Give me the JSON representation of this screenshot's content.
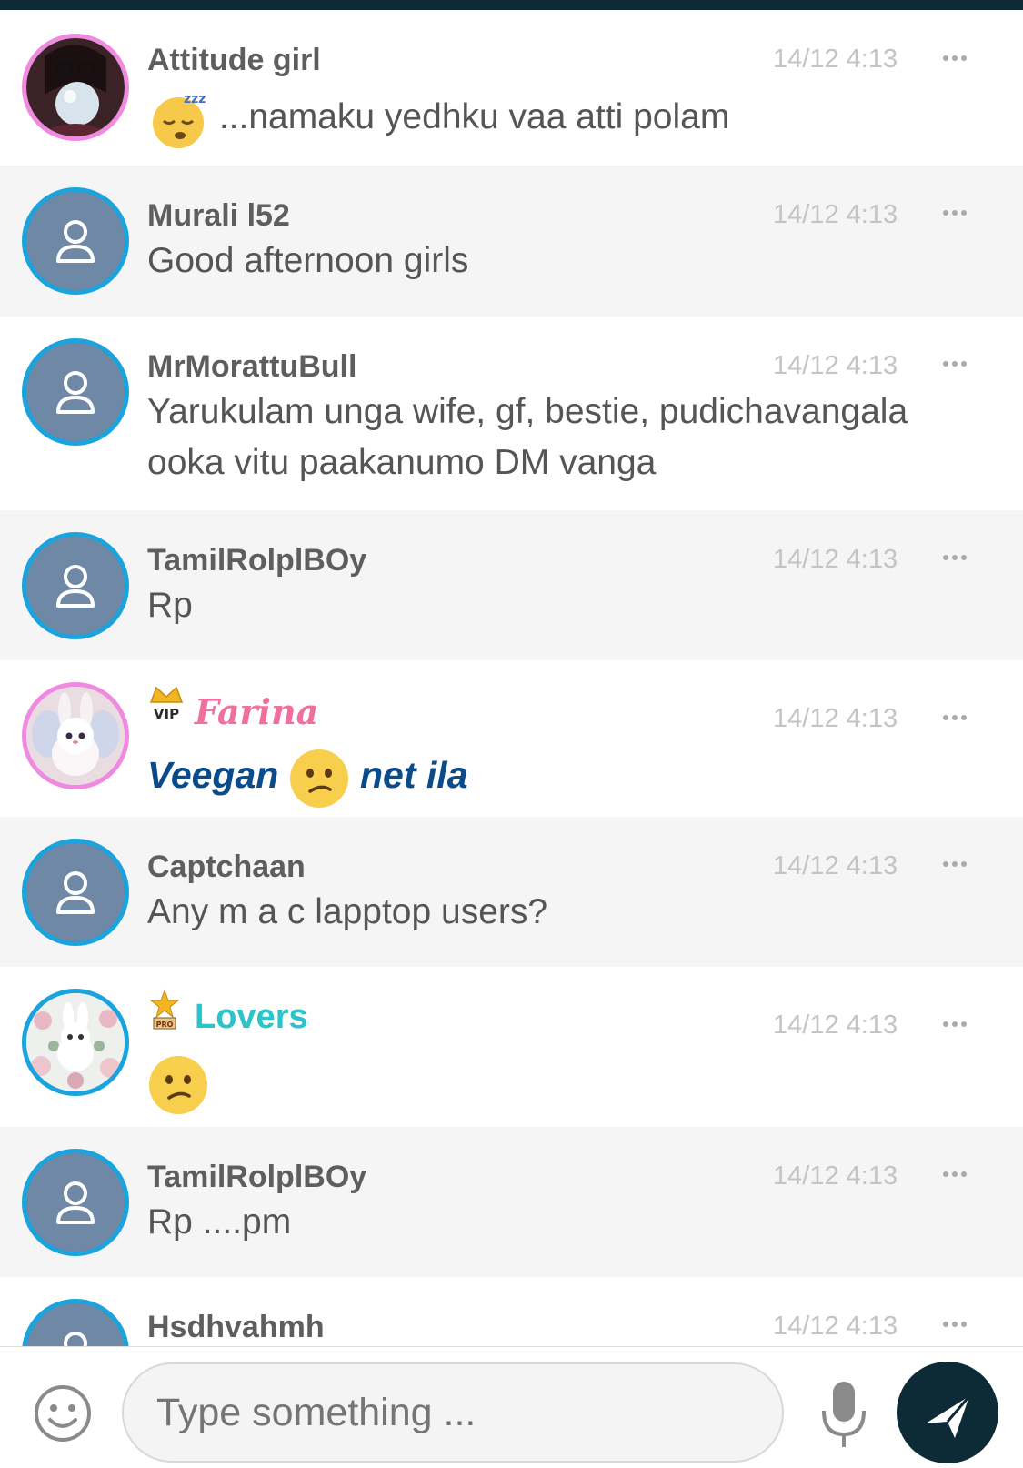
{
  "messages": [
    {
      "name": "Attitude girl",
      "time": "14/12 4:13",
      "text": "...namaku yedhku vaa atti polam",
      "avatar": "photo",
      "emoji": "sleeping-face"
    },
    {
      "name": "Murali l52",
      "time": "14/12 4:13",
      "text": "Good afternoon girls",
      "avatar": "default"
    },
    {
      "name": "MrMorattuBull",
      "time": "14/12 4:13",
      "text": "Yarukulam unga wife, gf, bestie, pudichavangala ooka vitu paakanumo DM vanga",
      "avatar": "default"
    },
    {
      "name": "TamilRolplBOy",
      "time": "14/12 4:13",
      "text": "Rp",
      "avatar": "default"
    },
    {
      "name": "Farina",
      "time": "14/12 4:13",
      "badge": "VIP",
      "text_before": "Veegan",
      "text_after": "net ila",
      "avatar": "bunny",
      "emoji": "confused-face"
    },
    {
      "name": "Captchaan",
      "time": "14/12 4:13",
      "text": "Any m a c lapptop users?",
      "avatar": "default"
    },
    {
      "name": "Lovers",
      "time": "14/12 4:13",
      "badge": "PRO",
      "avatar": "bunny-flowers",
      "emoji": "confused-face"
    },
    {
      "name": "TamilRolplBOy",
      "time": "14/12 4:13",
      "text": "Rp ....pm",
      "avatar": "default"
    },
    {
      "name": "Hsdhvahmh",
      "time": "14/12 4:13",
      "avatar": "default"
    }
  ],
  "composer": {
    "placeholder": "Type something ...",
    "emoji_icon": "smiley-icon",
    "mic_icon": "microphone-icon",
    "send_icon": "send-icon"
  },
  "colors": {
    "accent_dark": "#0d2b36",
    "avatar_ring_default": "#1aa3dc",
    "avatar_ring_special": "#f08ae0",
    "vip_name": "#f06f9e",
    "pro_name": "#2bc4c8",
    "styled_text": "#0a4b8c"
  }
}
